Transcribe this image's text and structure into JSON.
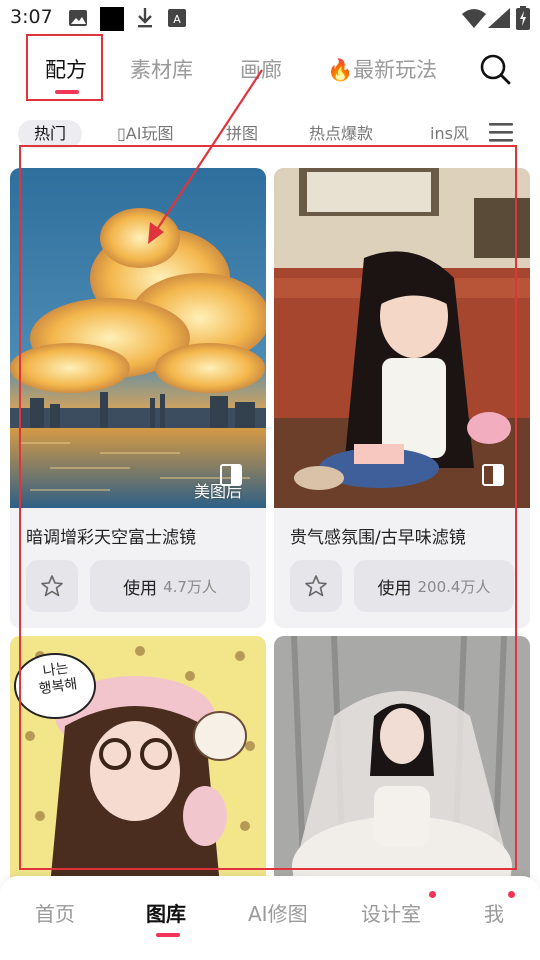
{
  "status_bar": {
    "time": "3:07",
    "icons": [
      "image-icon",
      "black-square-icon",
      "download-icon",
      "a-box-icon",
      "wifi-icon",
      "signal-icon",
      "battery-charging-icon"
    ]
  },
  "top_tabs": [
    {
      "label": "配方",
      "active": true
    },
    {
      "label": "素材库",
      "active": false
    },
    {
      "label": "画廊",
      "active": false
    },
    {
      "label": "🔥最新玩法",
      "active": false
    }
  ],
  "accent_color": "#f2365a",
  "annotation_color": "#e0343d",
  "chips": [
    {
      "label": "热门",
      "active": true
    },
    {
      "label": "▯AI玩图",
      "active": false
    },
    {
      "label": "拼图",
      "active": false
    },
    {
      "label": "热点爆款",
      "active": false
    },
    {
      "label": "ins风",
      "active": false
    }
  ],
  "cards": [
    {
      "title": "暗调增彩天空富士滤镜",
      "use_label": "使用",
      "use_count": "4.7万人",
      "watermark": "美图后"
    },
    {
      "title": "贵气感氛围/古早味滤镜",
      "use_label": "使用",
      "use_count": "200.4万人"
    },
    {
      "sticker_text": "나는\n행복해"
    }
  ],
  "bottom_nav": [
    {
      "label": "首页",
      "active": false,
      "badge": false
    },
    {
      "label": "图库",
      "active": true,
      "badge": false
    },
    {
      "label": "AI修图",
      "active": false,
      "badge": false
    },
    {
      "label": "设计室",
      "active": false,
      "badge": true
    },
    {
      "label": "我",
      "active": false,
      "badge": true
    }
  ]
}
